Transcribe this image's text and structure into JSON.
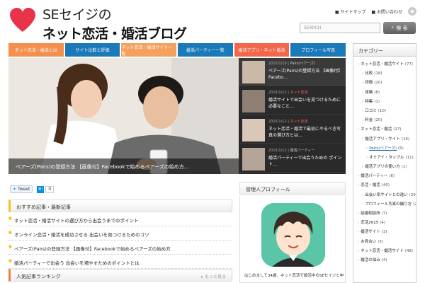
{
  "header": {
    "logo_line1": "SEセイジの",
    "logo_line2": "ネット恋活・婚活ブログ",
    "toplinks": [
      "■ サイトマップ",
      "■ お問い合わせ"
    ],
    "search_placeholder": "SEARCH",
    "search_button": "検 索"
  },
  "nav": [
    {
      "label": "ネット恋活・婚活とは",
      "color": "#f58f4d"
    },
    {
      "label": "サイト比較と評価",
      "color": "#1a79b8"
    },
    {
      "label": "ネット恋活・婚活サイト一覧",
      "color": "#f5a05c"
    },
    {
      "label": "婚活パーティー一覧",
      "color": "#1a79b8"
    },
    {
      "label": "婚活アプリ・ネット婚活",
      "color": "#f2674a"
    },
    {
      "label": "プロフィール写真",
      "color": "#1a79b8"
    }
  ],
  "slider": {
    "hero_caption": "ペアーズ(Pairs)の登録方法 【画像付】Facebookで始めるペアーズの始め方…",
    "slides": [
      {
        "date": "2015/1/19",
        "category": "Pairs(ペアーズ)",
        "title": "ペアーズ(Pairs)の登録方法 【画像付】Facebo…",
        "red": false
      },
      {
        "date": "2015/1/12",
        "category": "ネット恋活",
        "title": "婚活サイトで出会いを見つけるために必要なこと…",
        "red": true
      },
      {
        "date": "2015/1/12",
        "category": "ネット恋活",
        "title": "ネット恋活・婚活で最初にやるべき写真の選び方とは…",
        "red": true
      },
      {
        "date": "2015/1/12",
        "category": "婚活パーティー",
        "title": "婚活パーティーで出会うための ポイント…",
        "red": false
      }
    ]
  },
  "share": {
    "tweet": "Tweet",
    "hatena_count": "0"
  },
  "recent": {
    "title": "おすすめ記事・最新記事",
    "items": [
      "ネット恋活・婚活サイトの選び方から出会うまでのポイント",
      "オンライン恋活・婚活を成功させる 出会いを見つけるためのコツ",
      "ペアーズ(Pairs)の登録方法 【画像付】Facebookで始めるペアーズの始め方",
      "婚活パーティーで出会う 出会いを増やすためのポイントとは"
    ]
  },
  "popular": {
    "title": "人気記事ランキング",
    "more": "▸ もっと見る"
  },
  "profile": {
    "title": "管理人プロフィール",
    "text": "はじめまして34歳、ネット恋活で婚活中のSEセイジと申します。"
  },
  "sidebar": {
    "title": "カテゴリー",
    "items": [
      {
        "label": "ネット恋活・婚活サイト",
        "count": "(77)",
        "indent": 0
      },
      {
        "label": "比較",
        "count": "(18)",
        "indent": 1
      },
      {
        "label": "評価",
        "count": "(20)",
        "indent": 1
      },
      {
        "label": "体験",
        "count": "(8)",
        "indent": 1
      },
      {
        "label": "特集",
        "count": "(1)",
        "indent": 1
      },
      {
        "label": "口コミ",
        "count": "(10)",
        "indent": 1
      },
      {
        "label": "料金",
        "count": "(20)",
        "indent": 1
      },
      {
        "label": "ネット恋活・婚活",
        "count": "(17)",
        "indent": 0
      },
      {
        "label": "婚活アプリ・サイト",
        "count": "(16)",
        "indent": 1
      },
      {
        "label": "Pairs(ペアーズ)",
        "count": "(5)",
        "indent": 2,
        "link": true
      },
      {
        "label": "オミアイ・タップル",
        "count": "(11)",
        "indent": 2
      },
      {
        "label": "婚活アプリの使い方",
        "count": "(1)",
        "indent": 1
      },
      {
        "label": "婚活パーティー",
        "count": "(6)",
        "indent": 0
      },
      {
        "label": "恋活・婚活",
        "count": "(40)",
        "indent": 0
      },
      {
        "label": "出会い系サイトとの違い",
        "count": "(20)",
        "indent": 1
      },
      {
        "label": "プロフィール写真の撮り方",
        "count": "(20)",
        "indent": 1
      },
      {
        "label": "結婚相談所",
        "count": "(7)",
        "indent": 0
      },
      {
        "label": "恋活2015",
        "count": "(4)",
        "indent": 0
      },
      {
        "label": "婚活サイト",
        "count": "(3)",
        "indent": 0
      },
      {
        "label": "お見合い",
        "count": "(5)",
        "indent": 0
      },
      {
        "label": "ネット恋活・婚活サイト",
        "count": "(48)",
        "indent": 0
      },
      {
        "label": "婚活の悩み",
        "count": "(4)",
        "indent": 0
      }
    ]
  }
}
